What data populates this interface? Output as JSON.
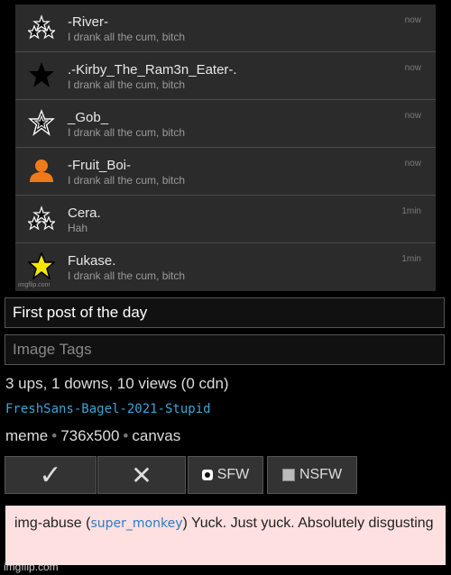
{
  "chat": {
    "rows": [
      {
        "name": "-River-",
        "message": "I drank all the cum, bitch",
        "time": "now",
        "icon": "three-stars-icon"
      },
      {
        "name": ".-Kirby_The_Ram3n_Eater-.",
        "message": "I drank all the cum, bitch",
        "time": "now",
        "icon": "black-star-icon"
      },
      {
        "name": "_Gob_",
        "message": "I drank all the cum, bitch",
        "time": "now",
        "icon": "outline-star-icon"
      },
      {
        "name": "-Fruit_Boi-",
        "message": "I drank all the cum, bitch",
        "time": "now",
        "icon": "orange-avatar-icon"
      },
      {
        "name": "Cera.",
        "message": "Hah",
        "time": "1min",
        "icon": "three-stars-icon"
      },
      {
        "name": "Fukase.",
        "message": "I drank all the cum, bitch",
        "time": "1min",
        "icon": "yellow-star-icon"
      }
    ],
    "watermark": "imgflip.com"
  },
  "post": {
    "title": "First post of the day",
    "tags_placeholder": "Image Tags",
    "stats": "3 ups, 1 downs, 10 views (0 cdn)",
    "username": "FreshSans-Bagel-2021-Stupid",
    "meta_type": "meme",
    "meta_size": "736x500",
    "meta_kind": "canvas",
    "meta_sep": "•"
  },
  "votes": {
    "up": "✓",
    "down": "✕",
    "sfw": "SFW",
    "nsfw": "NSFW"
  },
  "comment": {
    "prefix": "img-abuse (",
    "user": "super_monkey",
    "suffix": ") Yuck. Just yuck. Absolutely disgusting"
  },
  "watermark": "imgflip.com",
  "colors": {
    "accent_user": "#3aa6d8",
    "comment_bg": "#ffe0e0",
    "chat_bg": "#2b2b2b"
  }
}
